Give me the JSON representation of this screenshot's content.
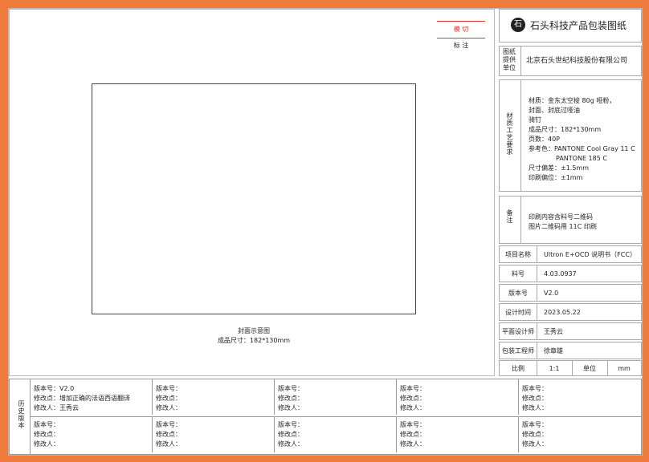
{
  "legend": {
    "die_cut": "模 切",
    "mark": "标 注"
  },
  "cover": {
    "caption": "封面示意图",
    "size_line": "成品尺寸：182*130mm"
  },
  "title_block": {
    "logo_char": "石",
    "company_title": "石头科技产品包装图纸",
    "provider_label": "图纸提供单位",
    "provider_value": "北京石头世纪科技股份有限公司",
    "material_label": "材质工艺要求",
    "material_lines": [
      "材质：金东太空梭 80g 哑粉，",
      "封面、封底过哑油",
      "骑钉",
      "成品尺寸：182*130mm",
      "页数：40P",
      "参考色：PANTONE Cool Gray 11 C",
      "PANTONE 185 C",
      "尺寸偏差：±1.5mm",
      "印刷偏位：±1mm"
    ],
    "notes_label": "备注",
    "notes_lines": [
      "印刷内容含料号二维码",
      "图片二维码用 11C 印刷"
    ],
    "rows": [
      {
        "label": "项目名称",
        "value": "Ultron E+OCD 说明书（FCC）"
      },
      {
        "label": "料号",
        "value": "4.03.0937"
      },
      {
        "label": "版本号",
        "value": "V2.0"
      },
      {
        "label": "设计时间",
        "value": "2023.05.22"
      },
      {
        "label": "平面设计师",
        "value": "王秀云"
      },
      {
        "label": "包装工程师",
        "value": "徐章雄"
      }
    ],
    "scale_label": "比例",
    "scale_value": "1:1",
    "unit_label": "单位",
    "unit_value": "mm"
  },
  "history": {
    "label": "历史版本",
    "row1": [
      {
        "ver": "版本号：V2.0",
        "change": "修改点：增加正确的法语西语翻译",
        "by": "修改人：王秀云"
      },
      {
        "ver": "版本号：",
        "change": "修改点：",
        "by": "修改人："
      },
      {
        "ver": "版本号：",
        "change": "修改点：",
        "by": "修改人："
      },
      {
        "ver": "版本号：",
        "change": "修改点：",
        "by": "修改人："
      },
      {
        "ver": "版本号：",
        "change": "修改点：",
        "by": "修改人："
      }
    ],
    "row2": [
      {
        "ver": "版本号：",
        "change": "修改点：",
        "by": "修改人："
      },
      {
        "ver": "版本号：",
        "change": "修改点：",
        "by": "修改人："
      },
      {
        "ver": "版本号：",
        "change": "修改点：",
        "by": "修改人："
      },
      {
        "ver": "版本号：",
        "change": "修改点：",
        "by": "修改人："
      },
      {
        "ver": "版本号：",
        "change": "修改点：",
        "by": "修改人："
      }
    ]
  }
}
